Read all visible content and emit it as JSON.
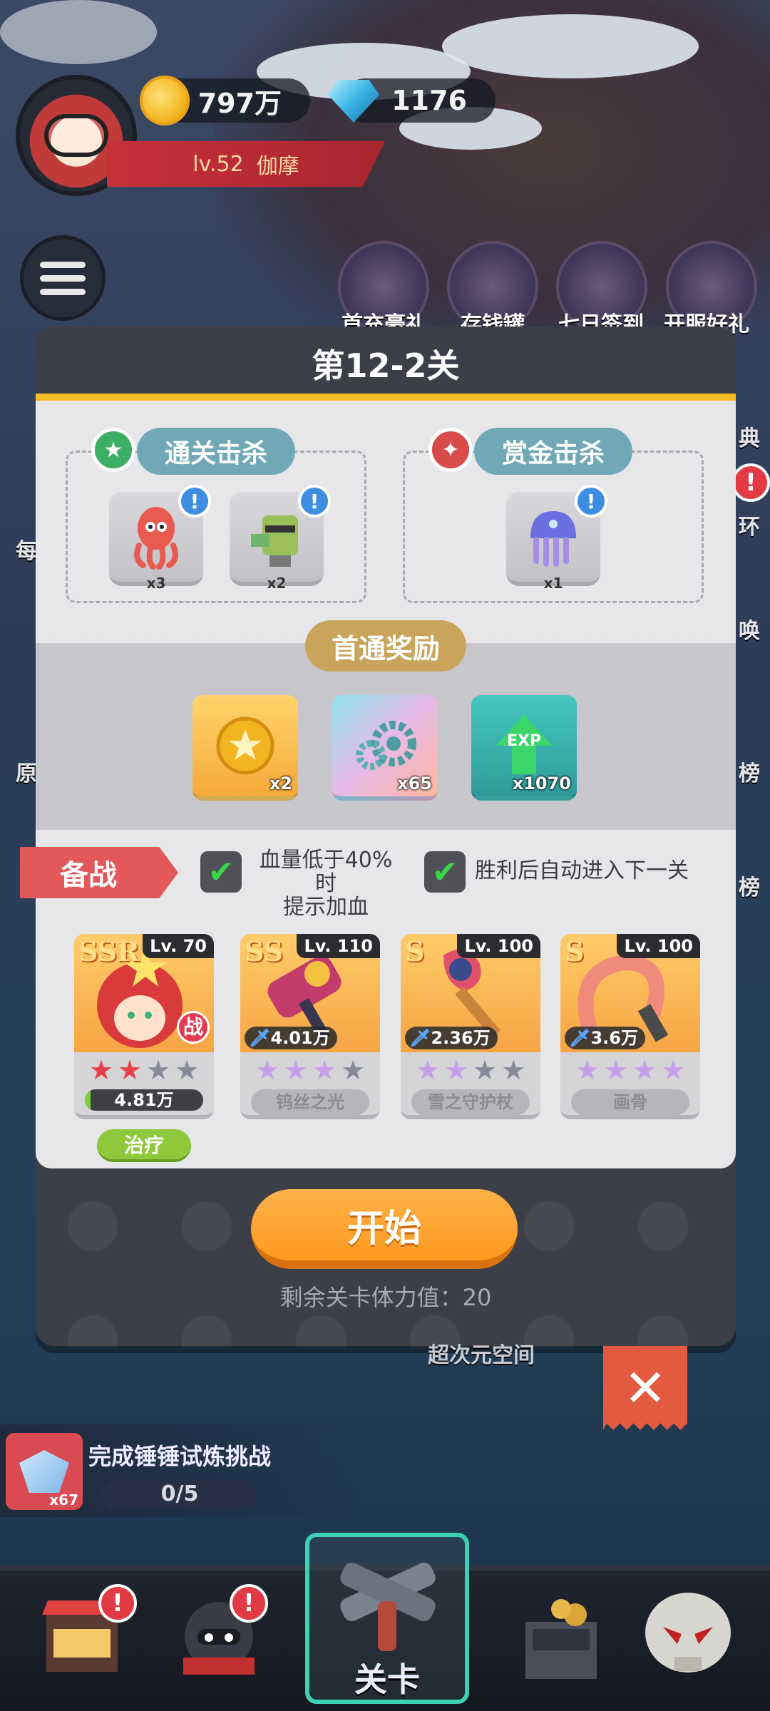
{
  "hud": {
    "coins": "797万",
    "gems": "1176",
    "level": "lv.52",
    "player_name": "伽摩"
  },
  "top_icons": [
    {
      "label": "首充豪礼"
    },
    {
      "label": "存钱罐"
    },
    {
      "label": "七日签到"
    },
    {
      "label": "开服好礼"
    }
  ],
  "behind_labels": {
    "left_1": "每",
    "left_2": "原",
    "right_1": "典",
    "right_2": "环",
    "right_3": "唤",
    "right_4": "榜",
    "right_5": "榜",
    "under_modal": "超次元空间"
  },
  "modal": {
    "title": "第12-2关",
    "clear_kill": {
      "label": "通关击杀",
      "monsters": [
        {
          "name": "squid-monster",
          "count": "x3"
        },
        {
          "name": "bandit-monster",
          "count": "x2"
        }
      ]
    },
    "bounty_kill": {
      "label": "赏金击杀",
      "monsters": [
        {
          "name": "jellyfish-monster",
          "count": "x1"
        }
      ]
    },
    "first_clear": {
      "label": "首通奖励",
      "rewards": [
        {
          "icon": "gold-star-coin-icon",
          "qty": "x2"
        },
        {
          "icon": "gear-icon",
          "qty": "x65"
        },
        {
          "icon": "exp-arrow-icon",
          "qty": "x1070",
          "text": "EXP"
        }
      ]
    },
    "battle": {
      "tag": "备战",
      "option_heal": {
        "label_line1": "血量低于40%时",
        "label_line2": "提示加血",
        "checked": true
      },
      "option_auto": {
        "label": "胜利后自动进入下一关",
        "checked": true
      }
    },
    "cards": [
      {
        "rarity": "SSR",
        "level": "Lv. 70",
        "tag": "战",
        "stars": 2,
        "max_stars": 4,
        "hp": "4.81万",
        "role": "治疗"
      },
      {
        "rarity": "SS",
        "level": "Lv. 110",
        "power": "4.01万",
        "stars": 3,
        "max_stars": 4,
        "name": "钨丝之光"
      },
      {
        "rarity": "S",
        "level": "Lv. 100",
        "power": "2.36万",
        "stars": 2,
        "max_stars": 4,
        "name": "雪之守护杖"
      },
      {
        "rarity": "S",
        "level": "Lv. 100",
        "power": "3.6万",
        "stars": 4,
        "max_stars": 4,
        "name": "画骨"
      }
    ],
    "start_label": "开始",
    "stamina_text": "剩余关卡体力值：20"
  },
  "task": {
    "title": "完成锤锤试炼挑战",
    "progress": "0/5",
    "icon_qty": "x67"
  },
  "nav": {
    "center_label": "关卡",
    "alert_mark": "!"
  },
  "colors": {
    "accent_gold": "#f3bb24",
    "start_orange": "#ff9a1f",
    "kill_teal": "#70a9b5",
    "battle_red": "#e3585a",
    "role_green": "#8fc83a"
  }
}
